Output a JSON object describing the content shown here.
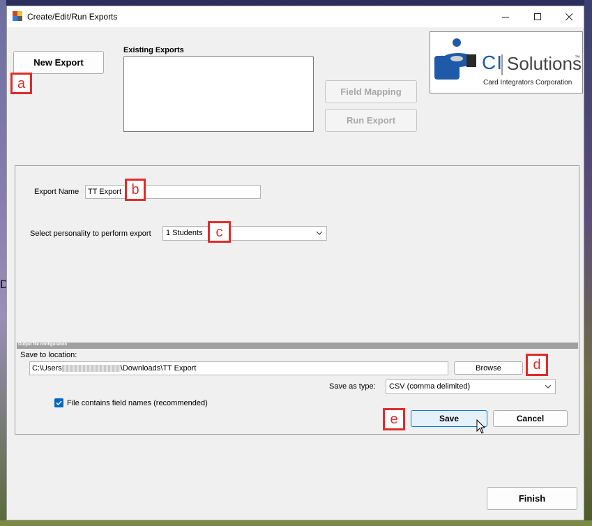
{
  "window": {
    "title": "Create/Edit/Run Exports",
    "controls": {
      "minimize": "—",
      "maximize": "☐",
      "close": "✕"
    }
  },
  "background_text": "Da",
  "top": {
    "new_export_label": "New Export",
    "existing_exports_label": "Existing Exports",
    "field_mapping_label": "Field Mapping",
    "run_export_label": "Run Export"
  },
  "logo": {
    "brand_ci": "CI",
    "brand_solutions": "Solutions",
    "tm": "™",
    "tagline": "Card Integrators Corporation"
  },
  "form": {
    "export_name_label": "Export Name",
    "export_name_value": "TT Export",
    "personality_label": "Select personality to perform export",
    "personality_value": "1  Students",
    "section_title": "Output file configuration",
    "save_location_label": "Save to location:",
    "path_prefix": "C:\\Users",
    "path_suffix": "\\Downloads\\TT Export",
    "browse_label": "Browse",
    "save_as_type_label": "Save as type:",
    "save_as_type_value": "CSV (comma delimited)",
    "field_names_label": "File contains field names (recommended)",
    "field_names_checked": true,
    "save_label": "Save",
    "cancel_label": "Cancel"
  },
  "finish_label": "Finish",
  "markers": {
    "a": "a",
    "b": "b",
    "c": "c",
    "d": "d",
    "e": "e"
  },
  "colors": {
    "marker": "#e12b2b",
    "checkbox": "#0067c0",
    "logo_blue": "#1f5aa8",
    "save_button_bg": "#e5f1fb",
    "save_button_border": "#0078d7"
  }
}
